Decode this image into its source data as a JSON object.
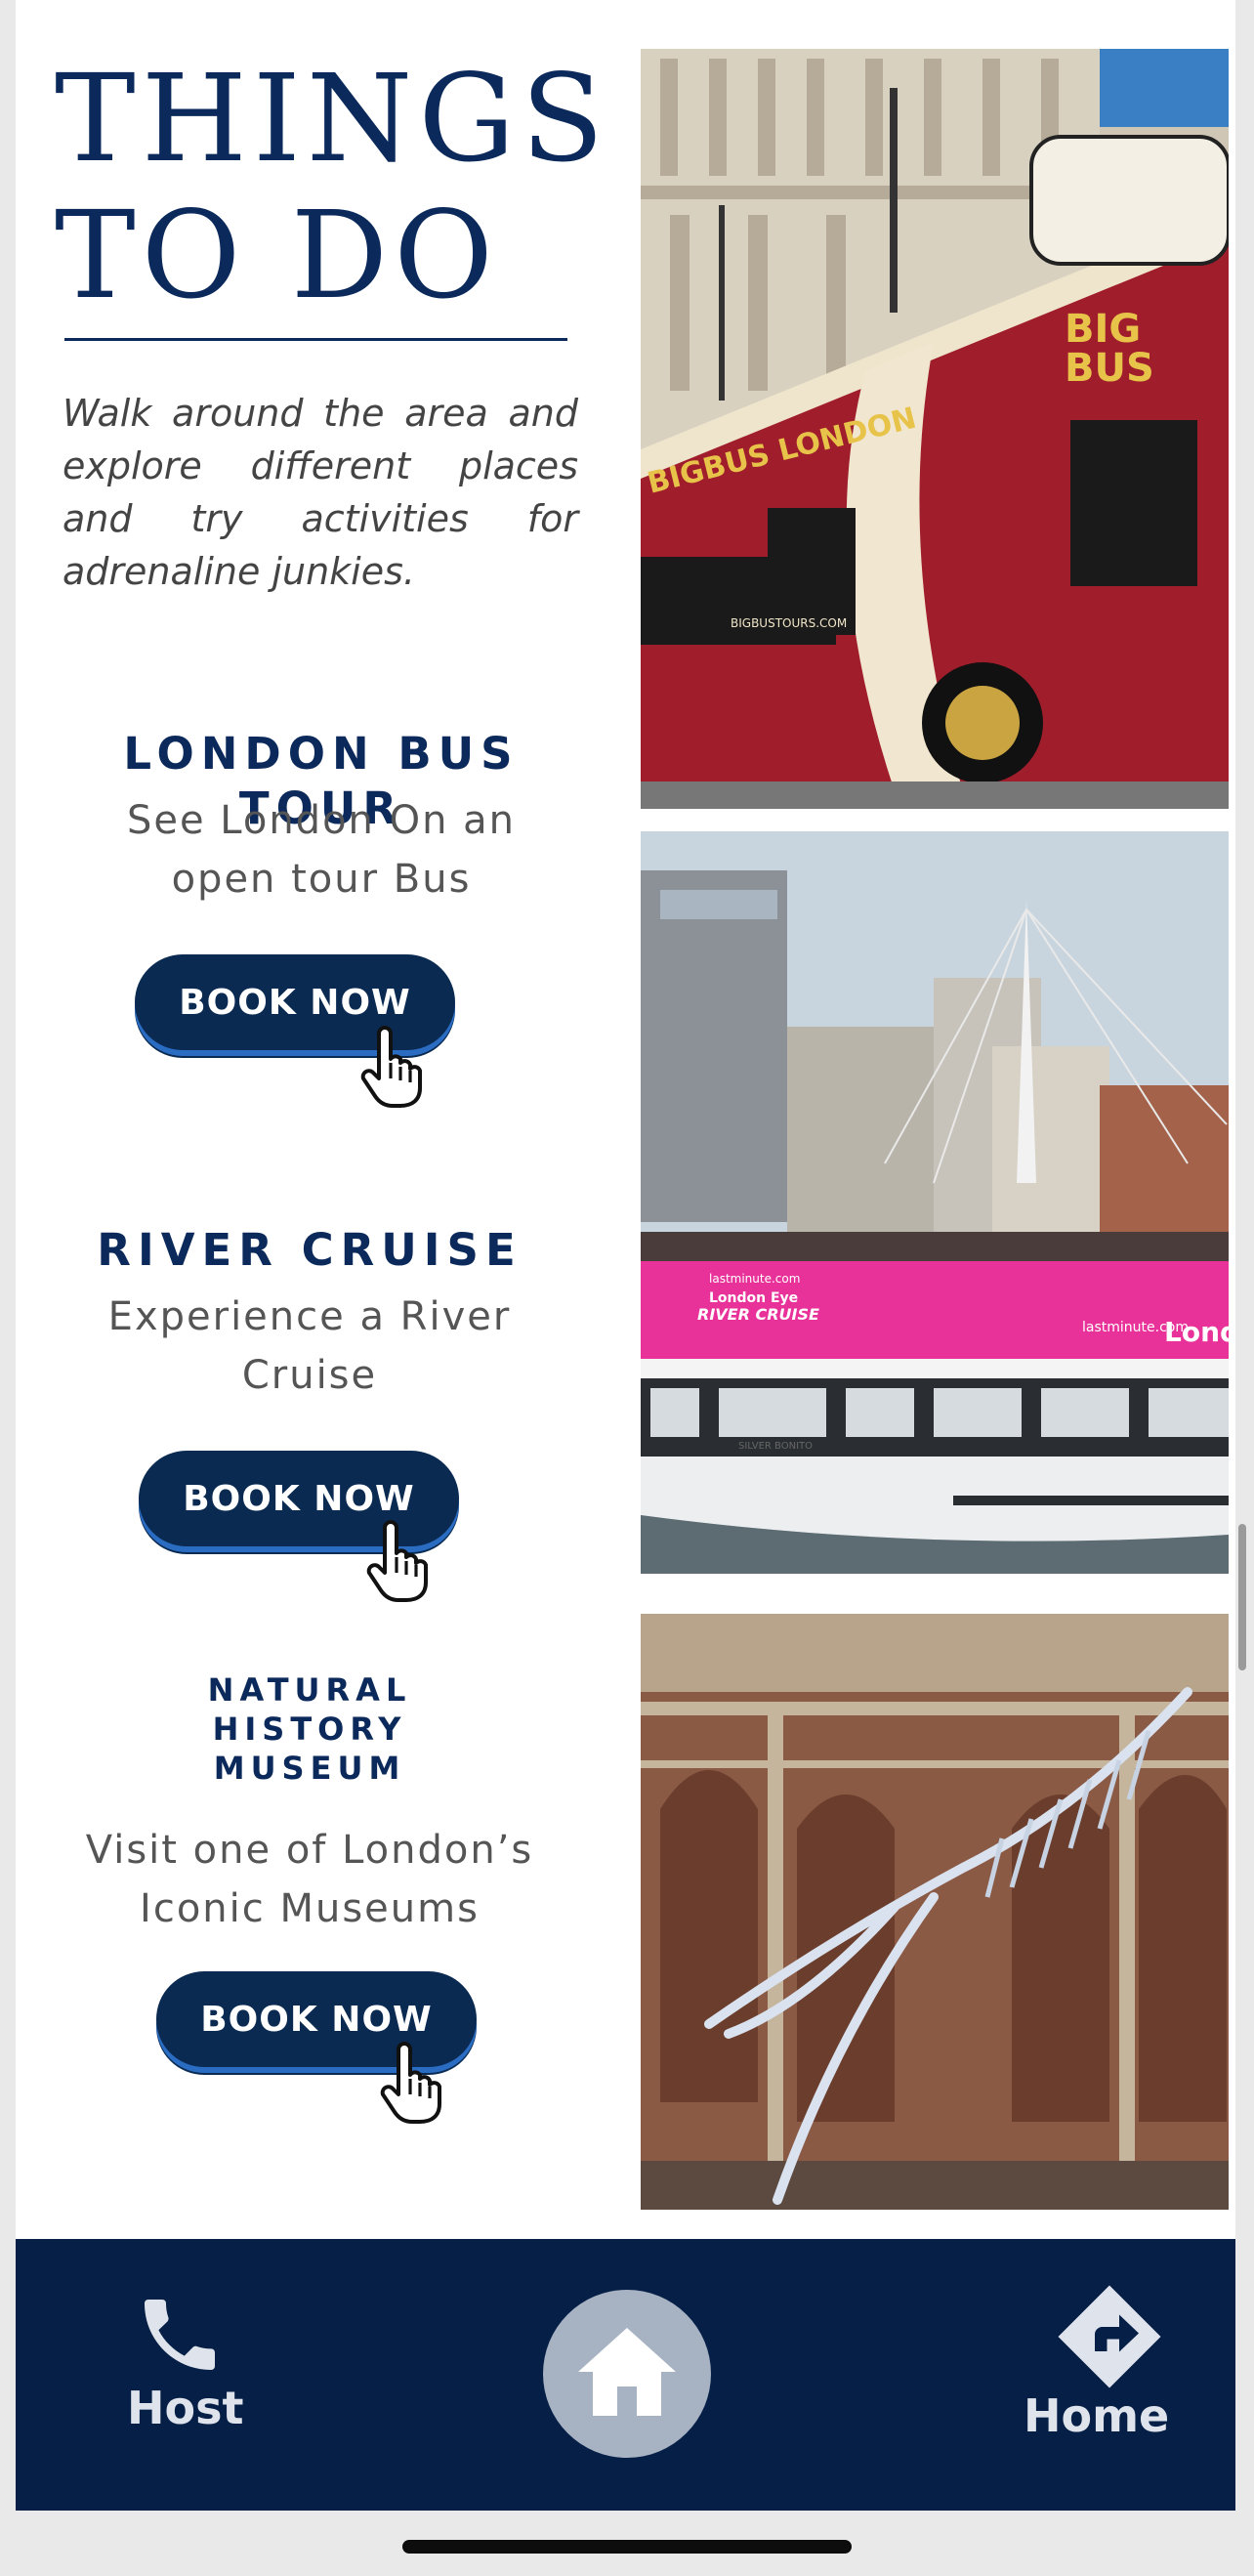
{
  "header": {
    "title_line1": "THINGS",
    "title_line2": "TO DO",
    "intro": "Walk around the area and explore different places and try activities for adrenaline junkies."
  },
  "activities": [
    {
      "title": "LONDON BUS TOUR",
      "desc_line1": "See London On an",
      "desc_line2": "open tour Bus",
      "button": "BOOK NOW",
      "photo_text": {
        "big_bus_1": "BIG",
        "big_bus_2": "BUS",
        "side": "BIGBUS LONDON",
        "url": "BIGBUSTOURS.COM"
      }
    },
    {
      "title": "RIVER CRUISE",
      "desc_line1": "Experience a River",
      "desc_line2": "Cruise",
      "button": "BOOK NOW",
      "photo_text": {
        "logo_top": "lastminute.com",
        "logo_mid": "London Eye",
        "logo_bottom": "RIVER CRUISE",
        "side_brand": "lastminute.com",
        "side_word": "London",
        "boat_name": "SILVER BONITO"
      }
    },
    {
      "title_line1": "NATURAL",
      "title_line2": "HISTORY",
      "title_line3": "MUSEUM",
      "desc_line1": "Visit one of London’s",
      "desc_line2": "Iconic Museums",
      "button": "BOOK NOW"
    }
  ],
  "nav": {
    "host_label": "Host",
    "home_label": "Home",
    "icons": [
      "phone-icon",
      "home-icon",
      "directions-icon"
    ]
  },
  "colors": {
    "navy": "#0b2a5b",
    "nav_bg": "#061f47",
    "button": "#0a2a52",
    "bus_red": "#9e1b2a",
    "cruise_pink": "#e8329a"
  }
}
